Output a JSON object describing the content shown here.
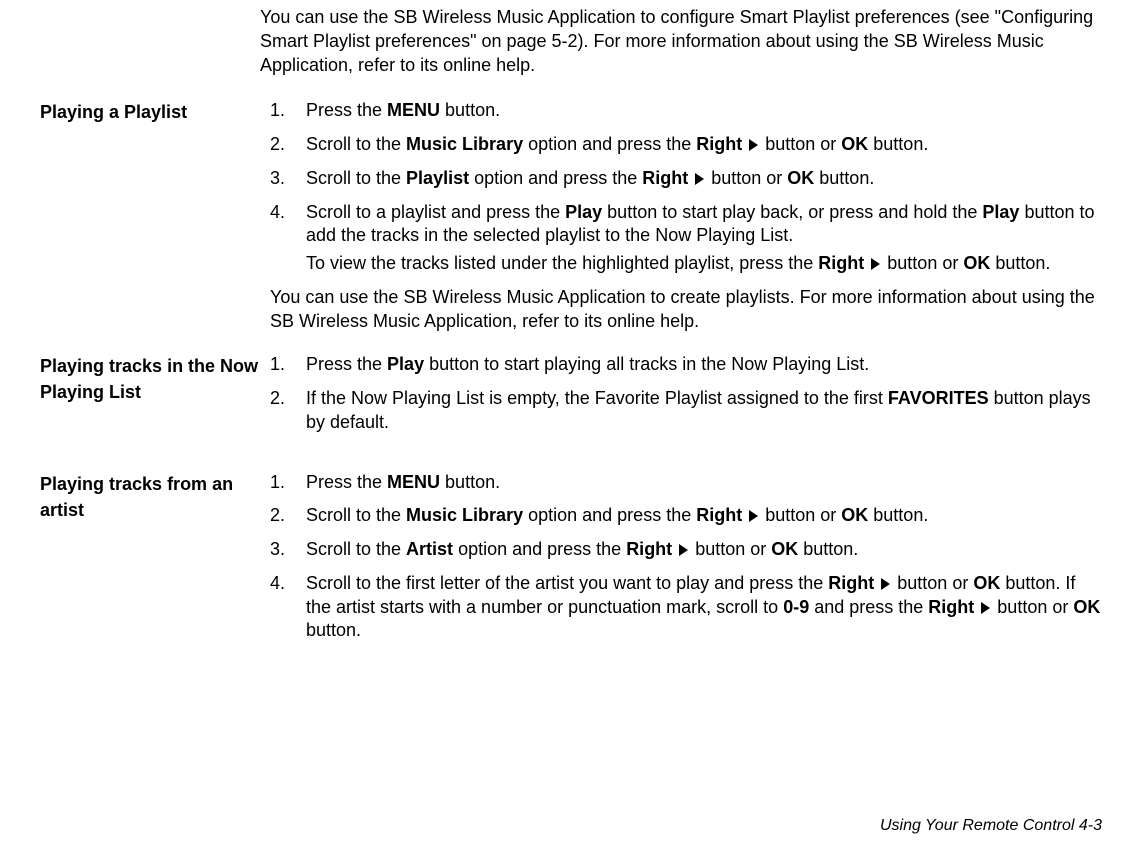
{
  "intro1": "You can use the SB Wireless Music Application to configure Smart Playlist preferences (see \"Configuring Smart Playlist preferences\" on page 5-2). For more information about using the SB Wireless Music Application, refer to its online help.",
  "sections": {
    "playlist": {
      "heading": "Playing a Playlist",
      "steps": {
        "s1_num": "1.",
        "s1_a": "Press the ",
        "s1_b": "MENU",
        "s1_c": " button.",
        "s2_num": "2.",
        "s2_a": "Scroll to the ",
        "s2_b": "Music Library",
        "s2_c": " option and press the ",
        "s2_d": "Right",
        "s2_e": " button or ",
        "s2_f": "OK",
        "s2_g": " button.",
        "s3_num": "3.",
        "s3_a": "Scroll to the ",
        "s3_b": "Playlist",
        "s3_c": " option and press the ",
        "s3_d": "Right",
        "s3_e": " button or ",
        "s3_f": "OK",
        "s3_g": " button.",
        "s4_num": "4.",
        "s4_a": "Scroll to a playlist and press the ",
        "s4_b": "Play",
        "s4_c": " button to start play back, or press and hold the ",
        "s4_d": "Play",
        "s4_e": "  button to add the tracks in the selected playlist to the Now Playing List.",
        "s4_sub_a": "To view the tracks listed under the highlighted playlist, press the ",
        "s4_sub_b": "Right",
        "s4_sub_c": " button or ",
        "s4_sub_d": "OK",
        "s4_sub_e": " button."
      },
      "after": "You can use the SB Wireless Music Application to create playlists. For more information about using the SB Wireless Music Application, refer to its online help."
    },
    "nowplaying": {
      "heading": "Playing tracks in the Now Playing List",
      "steps": {
        "s1_num": "1.",
        "s1_a": "Press the ",
        "s1_b": "Play",
        "s1_c": " button to start playing all tracks in the Now Playing List.",
        "s2_num": "2.",
        "s2_a": "If the Now Playing List is empty, the Favorite Playlist assigned to the first ",
        "s2_b": "FAVORITES",
        "s2_c": " button plays by default."
      }
    },
    "artist": {
      "heading": "Playing tracks from an artist",
      "steps": {
        "s1_num": "1.",
        "s1_a": "Press the ",
        "s1_b": "MENU",
        "s1_c": " button.",
        "s2_num": "2.",
        "s2_a": "Scroll to the ",
        "s2_b": "Music Library",
        "s2_c": " option and press the ",
        "s2_d": "Right",
        "s2_e": " button or ",
        "s2_f": "OK",
        "s2_g": " button.",
        "s3_num": "3.",
        "s3_a": "Scroll to the ",
        "s3_b": "Artist",
        "s3_c": " option and press the ",
        "s3_d": "Right",
        "s3_e": " button or ",
        "s3_f": "OK",
        "s3_g": " button.",
        "s4_num": "4.",
        "s4_a": "Scroll to the first letter of the artist you want to play and press the ",
        "s4_b": "Right",
        "s4_c": " button or ",
        "s4_d": "OK",
        "s4_e": " button. If the artist starts with a number or punctuation mark, scroll to ",
        "s4_f": "0-9",
        "s4_g": " and press the ",
        "s4_h": "Right",
        "s4_i": " button or ",
        "s4_j": "OK",
        "s4_k": " button."
      }
    }
  },
  "footer": "Using Your Remote Control  4-3"
}
